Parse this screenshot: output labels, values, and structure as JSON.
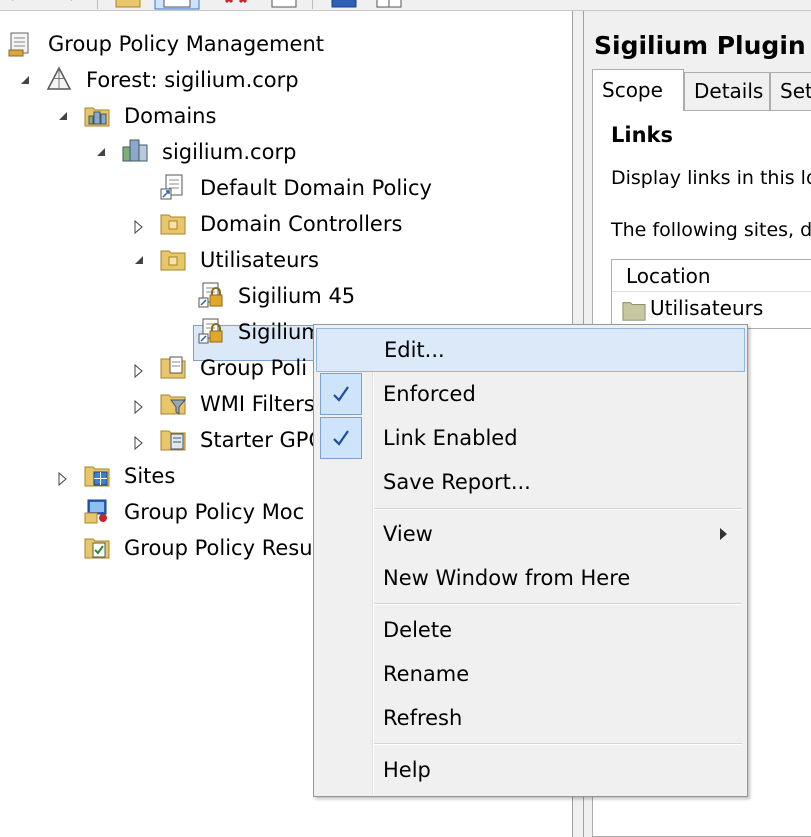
{
  "tree": {
    "root": "Group Policy Management",
    "forest": "Forest: sigilium.corp",
    "domains": "Domains",
    "domain": "sigilium.corp",
    "default_policy": "Default Domain Policy",
    "domain_controllers": "Domain Controllers",
    "utilisateurs": "Utilisateurs",
    "gpo_link_1": "Sigilium 45",
    "gpo_link_selected": "Sigilium",
    "group_policy_objects": "Group Poli",
    "wmi_filters": "WMI Filters",
    "starter_gpos": "Starter GPO",
    "sites": "Sites",
    "modeling": "Group Policy Moc",
    "results": "Group Policy Resu"
  },
  "right_pane": {
    "title": "Sigilium Plugin",
    "tabs": [
      "Scope",
      "Details",
      "Set"
    ],
    "links_heading": "Links",
    "display_links_text": "Display links in this loc",
    "following_sites_text": "The following sites, do",
    "table_header": "Location",
    "table_row": "Utilisateurs"
  },
  "context_menu": {
    "items": [
      {
        "label": "Edit...",
        "hot": true
      },
      {
        "label": "Enforced",
        "checked": true
      },
      {
        "label": "Link Enabled",
        "checked": true
      },
      {
        "label": "Save Report..."
      },
      {
        "label": "View",
        "submenu": true
      },
      {
        "label": "New Window from Here"
      },
      {
        "label": "Delete"
      },
      {
        "label": "Rename"
      },
      {
        "label": "Refresh"
      },
      {
        "label": "Help"
      }
    ]
  },
  "colors": {
    "selection_bg": "#dbe8f7",
    "menu_hot_bg": "#dbe9f9",
    "menu_hot_border": "#8fb7e4",
    "check_color": "#1a4fa0",
    "folder_yellow": "#e8c66a"
  }
}
